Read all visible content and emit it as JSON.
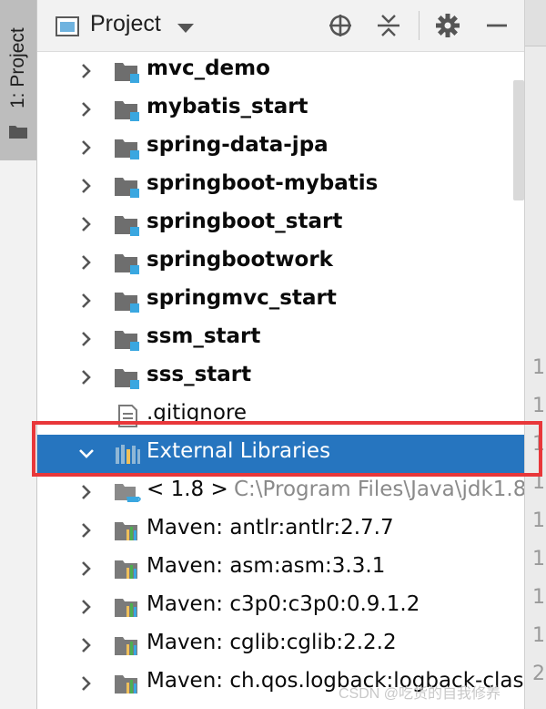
{
  "side_tab": {
    "label": "1: Project"
  },
  "header": {
    "title": "Project"
  },
  "tree_rows": [
    {
      "label": "mvc_demo",
      "bold": true,
      "icon": "module-folder-icon",
      "expandable": true
    },
    {
      "label": "mybatis_start",
      "bold": true,
      "icon": "module-folder-icon",
      "expandable": true
    },
    {
      "label": "spring-data-jpa",
      "bold": true,
      "icon": "module-folder-icon",
      "expandable": true
    },
    {
      "label": "springboot-mybatis",
      "bold": true,
      "icon": "module-folder-icon",
      "expandable": true
    },
    {
      "label": "springboot_start",
      "bold": true,
      "icon": "module-folder-icon",
      "expandable": true
    },
    {
      "label": "springbootwork",
      "bold": true,
      "icon": "module-folder-icon",
      "expandable": true
    },
    {
      "label": "springmvc_start",
      "bold": true,
      "icon": "module-folder-icon",
      "expandable": true
    },
    {
      "label": "ssm_start",
      "bold": true,
      "icon": "module-folder-icon",
      "expandable": true
    },
    {
      "label": "sss_start",
      "bold": true,
      "icon": "module-folder-icon",
      "expandable": true
    },
    {
      "label": ".gitignore",
      "bold": false,
      "icon": "file-icon",
      "expandable": false
    },
    {
      "label": "External Libraries",
      "bold": false,
      "icon": "libraries-icon",
      "expandable": true,
      "expanded": true,
      "selected": true
    },
    {
      "label": "< 1.8 >",
      "path": "C:\\Program Files\\Java\\jdk1.8",
      "bold": false,
      "icon": "jdk-icon",
      "expandable": true
    },
    {
      "label": "Maven: antlr:antlr:2.7.7",
      "bold": false,
      "icon": "library-icon",
      "expandable": true
    },
    {
      "label": "Maven: asm:asm:3.3.1",
      "bold": false,
      "icon": "library-icon",
      "expandable": true
    },
    {
      "label": "Maven: c3p0:c3p0:0.9.1.2",
      "bold": false,
      "icon": "library-icon",
      "expandable": true
    },
    {
      "label": "Maven: cglib:cglib:2.2.2",
      "bold": false,
      "icon": "library-icon",
      "expandable": true
    },
    {
      "label": "Maven: ch.qos.logback:logback-classic",
      "bold": false,
      "icon": "library-icon",
      "expandable": true
    }
  ],
  "gutter_numbers": [
    "1",
    "1",
    "1",
    "1",
    "1",
    "1",
    "1",
    "1",
    "2"
  ],
  "watermark": "CSDN @吃货的自我修养",
  "colors": {
    "selection": "#2675bf",
    "highlight_border": "#e8373a",
    "module_dot": "#3aa7e0"
  }
}
